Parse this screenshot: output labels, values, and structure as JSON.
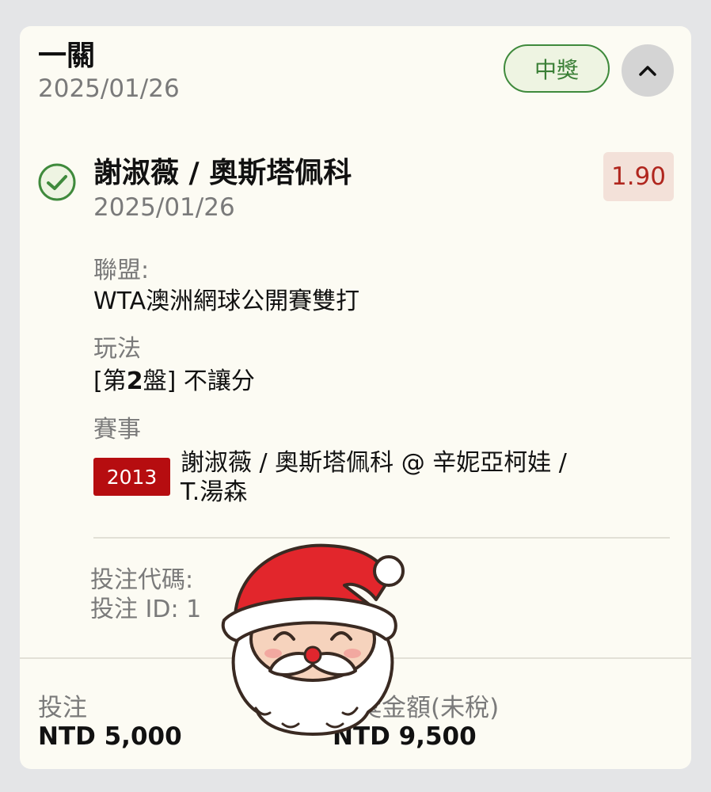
{
  "header": {
    "title": "一關",
    "date": "2025/01/26",
    "status_badge": "中獎",
    "collapse_icon": "chevron-up-icon"
  },
  "selection": {
    "status_icon": "check-circle-icon",
    "title": "謝淑薇 / 奧斯塔佩科",
    "date": "2025/01/26",
    "odds": "1.90",
    "league_label": "聯盟:",
    "league_value": "WTA澳洲網球公開賽雙打",
    "market_label": "玩法",
    "market_prefix": "[第",
    "market_number": "2",
    "market_mid": "盤]",
    "market_suffix": " 不讓分",
    "event_label": "賽事",
    "event_code": "2013",
    "event_name": "謝淑薇 / 奧斯塔佩科 @ 辛妮亞柯娃 / T.湯森"
  },
  "bet_info": {
    "code_text": "投注代碼:",
    "id_text": "投注 ID: 1"
  },
  "footer": {
    "stake_label": "投注",
    "stake_value": "NTD 5,000",
    "payout_label": "中獎金額(未稅)",
    "payout_value": "NTD 9,500"
  },
  "colors": {
    "card_bg": "#fcfbf3",
    "win_green": "#3a7f36",
    "odds_red": "#b0261e",
    "event_code_red": "#b60d10"
  },
  "decoration": {
    "sticker_icon": "santa-claus-sticker"
  }
}
